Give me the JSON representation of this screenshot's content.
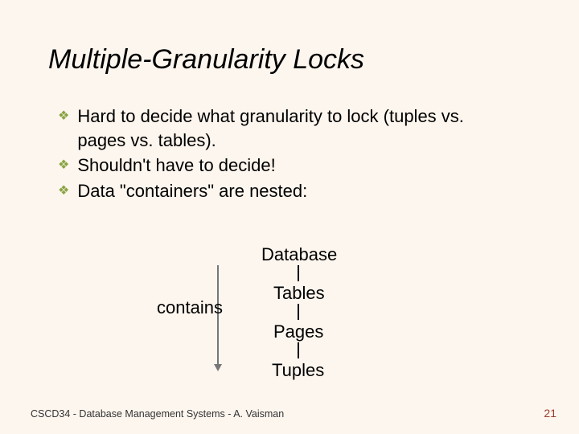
{
  "title": "Multiple-Granularity Locks",
  "bullets": [
    "Hard to decide what granularity to lock (tuples vs. pages vs. tables).",
    "Shouldn't have to decide!",
    "Data \"containers\" are nested:"
  ],
  "bullet_glyph": "❖",
  "diagram": {
    "side_label": "contains",
    "levels": [
      "Database",
      "Tables",
      "Pages",
      "Tuples"
    ]
  },
  "footer": "CSCD34 - Database Management Systems - A. Vaisman",
  "page_number": "21"
}
